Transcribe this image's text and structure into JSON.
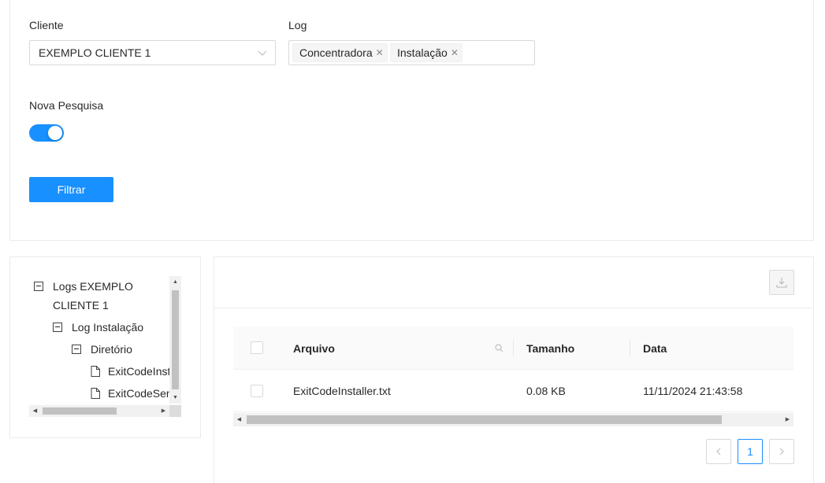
{
  "filters": {
    "cliente_label": "Cliente",
    "cliente_value": "EXEMPLO CLIENTE 1",
    "log_label": "Log",
    "log_tags": [
      "Concentradora",
      "Instalação"
    ],
    "nova_pesquisa_label": "Nova Pesquisa",
    "nova_pesquisa_on": true,
    "filtrar_label": "Filtrar"
  },
  "tree": {
    "root_line1": "Logs EXEMPLO",
    "root_line2": "CLIENTE 1",
    "child": "Log Instalação",
    "grandchild": "Diretório",
    "files": [
      "ExitCodeInstaller.txt",
      "ExitCodeSender.txt"
    ]
  },
  "table": {
    "columns": [
      "Arquivo",
      "Tamanho",
      "Data"
    ],
    "rows": [
      {
        "arquivo": "ExitCodeInstaller.txt",
        "tamanho": "0.08 KB",
        "data": "11/11/2024 21:43:58"
      }
    ]
  },
  "pagination": {
    "current": "1"
  },
  "colors": {
    "primary": "#1890ff",
    "border": "#d9d9d9"
  },
  "icons": [
    "chevron-down-icon",
    "close-icon",
    "minus-square-icon",
    "file-icon",
    "download-icon",
    "search-icon",
    "left-icon",
    "right-icon"
  ]
}
